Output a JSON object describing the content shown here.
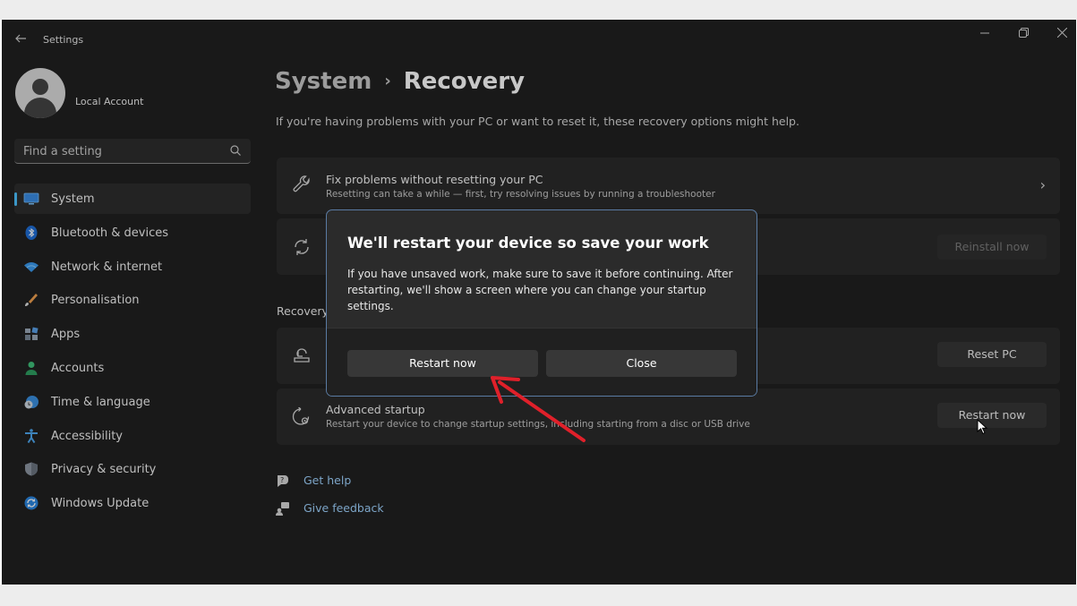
{
  "window": {
    "app_title": "Settings",
    "controls": [
      "minimize-icon",
      "restore-icon",
      "close-icon"
    ]
  },
  "account": {
    "name": "Local Account"
  },
  "search": {
    "placeholder": "Find a setting"
  },
  "sidebar": {
    "items": [
      {
        "label": "System",
        "icon": "system-monitor-icon",
        "selected": true
      },
      {
        "label": "Bluetooth & devices",
        "icon": "bluetooth-icon",
        "selected": false
      },
      {
        "label": "Network & internet",
        "icon": "wifi-icon",
        "selected": false
      },
      {
        "label": "Personalisation",
        "icon": "brush-icon",
        "selected": false
      },
      {
        "label": "Apps",
        "icon": "apps-icon",
        "selected": false
      },
      {
        "label": "Accounts",
        "icon": "accounts-icon",
        "selected": false
      },
      {
        "label": "Time & language",
        "icon": "globe-clock-icon",
        "selected": false
      },
      {
        "label": "Accessibility",
        "icon": "accessibility-icon",
        "selected": false
      },
      {
        "label": "Privacy & security",
        "icon": "shield-icon",
        "selected": false
      },
      {
        "label": "Windows Update",
        "icon": "update-icon",
        "selected": false
      }
    ]
  },
  "breadcrumb": {
    "root": "System",
    "separator": "›",
    "current": "Recovery"
  },
  "subtitle": "If you're having problems with your PC or want to reset it, these recovery options might help.",
  "cards": {
    "fix": {
      "title": "Fix problems without resetting your PC",
      "desc": "Resetting can take a while — first, try resolving issues by running a troubleshooter"
    },
    "reinstall": {
      "button": "Reinstall now"
    },
    "reset": {
      "button": "Reset PC"
    },
    "advanced": {
      "title": "Advanced startup",
      "desc": "Restart your device to change startup settings, including starting from a disc or USB drive",
      "button": "Restart now"
    }
  },
  "recovery_section_label": "Recovery",
  "links": {
    "help": "Get help",
    "feedback": "Give feedback"
  },
  "dialog": {
    "title": "We'll restart your device so save your work",
    "body": "If you have unsaved work, make sure to save it before continuing. After restarting, we'll show a screen where you can change your startup settings.",
    "primary": "Restart now",
    "secondary": "Close"
  },
  "colors": {
    "accent": "#4cc2ff",
    "window_bg": "#202020",
    "card_bg": "#2b2b2b",
    "link": "#9fd3ff",
    "annotation_arrow": "#e0202a"
  }
}
